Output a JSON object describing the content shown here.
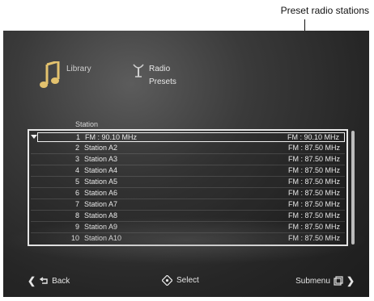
{
  "annotation": {
    "callout": "Preset radio stations"
  },
  "header": {
    "library_label": "Library",
    "radio_label": "Radio",
    "presets_label": "Presets"
  },
  "list": {
    "column_header": "Station",
    "rows": [
      {
        "num": "1",
        "name": "FM : 90.10  MHz",
        "freq": "FM :  90.10   MHz",
        "selected": true
      },
      {
        "num": "2",
        "name": "Station A2",
        "freq": "FM :  87.50   MHz"
      },
      {
        "num": "3",
        "name": "Station A3",
        "freq": "FM :  87.50   MHz"
      },
      {
        "num": "4",
        "name": "Station A4",
        "freq": "FM :  87.50   MHz"
      },
      {
        "num": "5",
        "name": "Station A5",
        "freq": "FM :  87.50   MHz"
      },
      {
        "num": "6",
        "name": "Station A6",
        "freq": "FM :  87.50   MHz"
      },
      {
        "num": "7",
        "name": "Station A7",
        "freq": "FM :  87.50   MHz"
      },
      {
        "num": "8",
        "name": "Station A8",
        "freq": "FM :  87.50   MHz"
      },
      {
        "num": "9",
        "name": "Station A9",
        "freq": "FM :  87.50   MHz"
      },
      {
        "num": "10",
        "name": "Station A10",
        "freq": "FM :  87.50   MHz"
      }
    ]
  },
  "footer": {
    "back_label": "Back",
    "select_label": "Select",
    "submenu_label": "Submenu"
  },
  "icons": [
    "music-note-icon",
    "antenna-icon",
    "back-arrow-icon",
    "select-dpad-icon",
    "submenu-icon",
    "chevron-left-icon",
    "chevron-right-icon",
    "dropdown-arrow-icon"
  ]
}
